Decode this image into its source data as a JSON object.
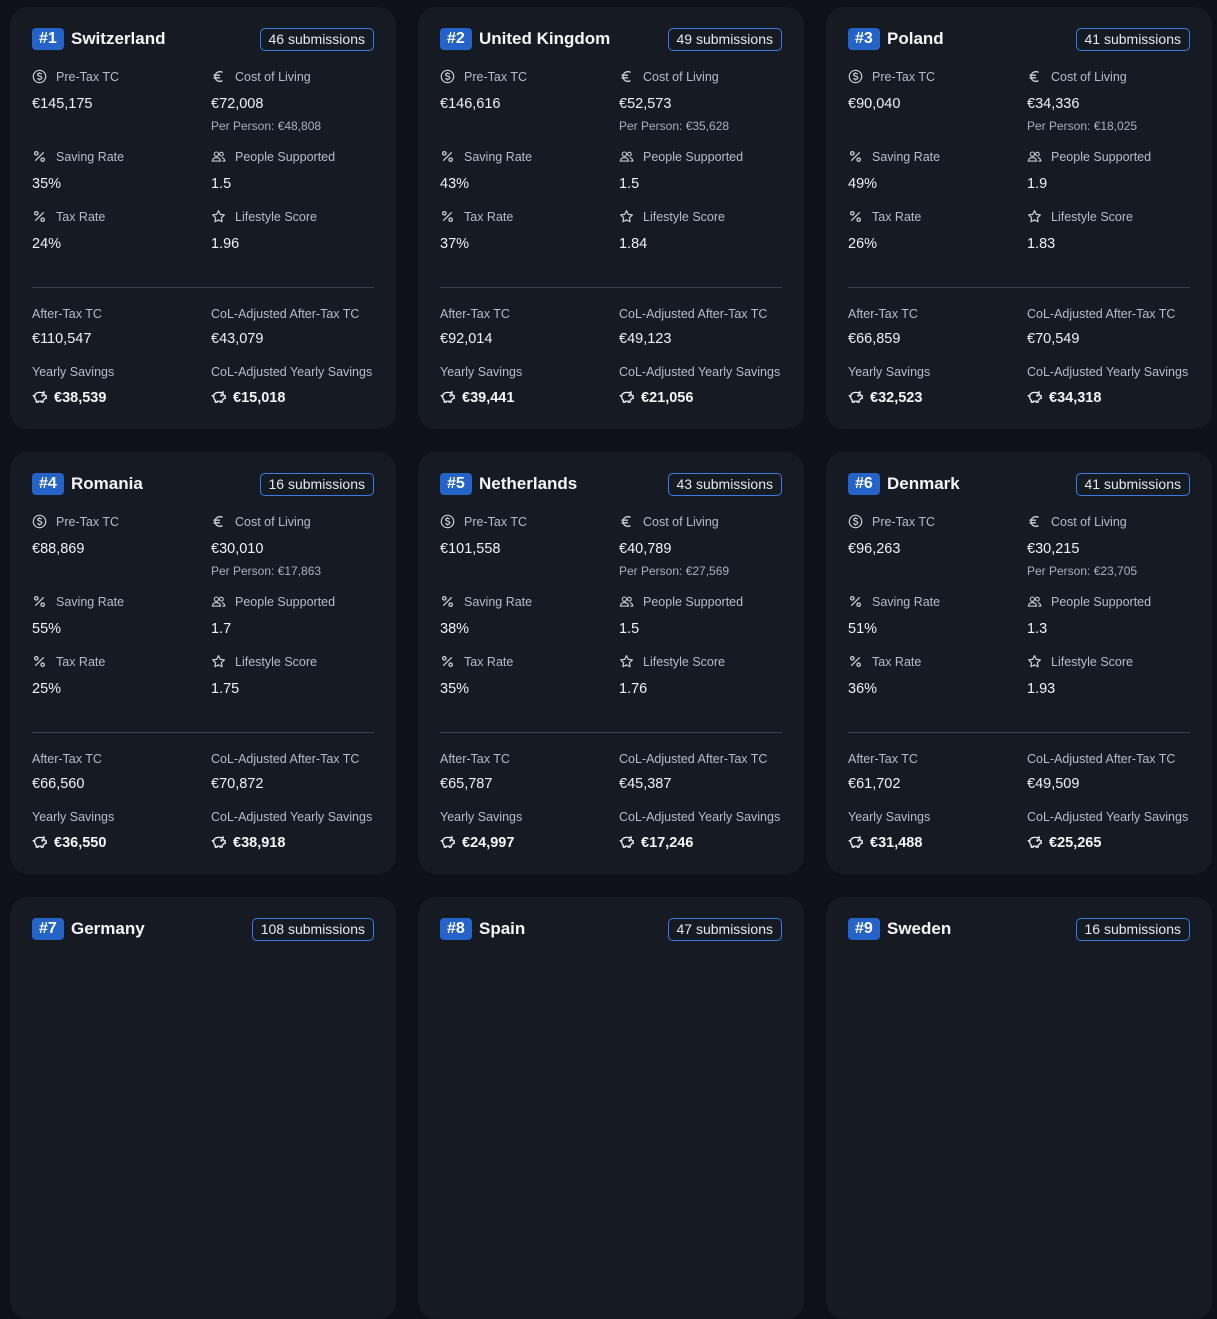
{
  "labels": {
    "pretax": "Pre-Tax TC",
    "col": "Cost of Living",
    "saving": "Saving Rate",
    "people": "People Supported",
    "tax": "Tax Rate",
    "lifestyle": "Lifestyle Score",
    "aftertax": "After-Tax TC",
    "col_aftertax": "CoL-Adjusted After-Tax TC",
    "savings": "Yearly Savings",
    "col_savings": "CoL-Adjusted Yearly Savings"
  },
  "colors": {
    "accent": "#2563c9",
    "card": "#161b23",
    "background": "#0e1117"
  },
  "cards": [
    {
      "rank": "#1",
      "country": "Switzerland",
      "subs": "46 submissions",
      "pretax": "€145,175",
      "col": "€72,008",
      "per_person": "Per Person: €48,808",
      "saving": "35%",
      "people": "1.5",
      "tax": "24%",
      "lifestyle": "1.96",
      "aftertax": "€110,547",
      "col_aftertax": "€43,079",
      "savings": "€38,539",
      "col_savings": "€15,018"
    },
    {
      "rank": "#2",
      "country": "United Kingdom",
      "subs": "49 submissions",
      "pretax": "€146,616",
      "col": "€52,573",
      "per_person": "Per Person: €35,628",
      "saving": "43%",
      "people": "1.5",
      "tax": "37%",
      "lifestyle": "1.84",
      "aftertax": "€92,014",
      "col_aftertax": "€49,123",
      "savings": "€39,441",
      "col_savings": "€21,056"
    },
    {
      "rank": "#3",
      "country": "Poland",
      "subs": "41 submissions",
      "pretax": "€90,040",
      "col": "€34,336",
      "per_person": "Per Person: €18,025",
      "saving": "49%",
      "people": "1.9",
      "tax": "26%",
      "lifestyle": "1.83",
      "aftertax": "€66,859",
      "col_aftertax": "€70,549",
      "savings": "€32,523",
      "col_savings": "€34,318"
    },
    {
      "rank": "#4",
      "country": "Romania",
      "subs": "16 submissions",
      "pretax": "€88,869",
      "col": "€30,010",
      "per_person": "Per Person: €17,863",
      "saving": "55%",
      "people": "1.7",
      "tax": "25%",
      "lifestyle": "1.75",
      "aftertax": "€66,560",
      "col_aftertax": "€70,872",
      "savings": "€36,550",
      "col_savings": "€38,918"
    },
    {
      "rank": "#5",
      "country": "Netherlands",
      "subs": "43 submissions",
      "pretax": "€101,558",
      "col": "€40,789",
      "per_person": "Per Person: €27,569",
      "saving": "38%",
      "people": "1.5",
      "tax": "35%",
      "lifestyle": "1.76",
      "aftertax": "€65,787",
      "col_aftertax": "€45,387",
      "savings": "€24,997",
      "col_savings": "€17,246"
    },
    {
      "rank": "#6",
      "country": "Denmark",
      "subs": "41 submissions",
      "pretax": "€96,263",
      "col": "€30,215",
      "per_person": "Per Person: €23,705",
      "saving": "51%",
      "people": "1.3",
      "tax": "36%",
      "lifestyle": "1.93",
      "aftertax": "€61,702",
      "col_aftertax": "€49,509",
      "savings": "€31,488",
      "col_savings": "€25,265"
    },
    {
      "rank": "#7",
      "country": "Germany",
      "subs": "108 submissions"
    },
    {
      "rank": "#8",
      "country": "Spain",
      "subs": "47 submissions"
    },
    {
      "rank": "#9",
      "country": "Sweden",
      "subs": "16 submissions"
    }
  ]
}
